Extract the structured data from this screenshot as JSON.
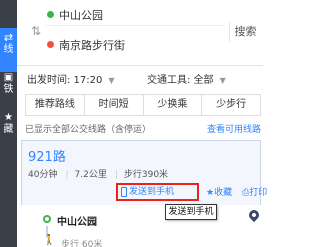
{
  "sidebar": {
    "items": [
      {
        "label": "线",
        "icon": "route-icon"
      },
      {
        "label": "铁",
        "icon": "bus-icon"
      },
      {
        "label": "藏",
        "icon": "star-icon"
      }
    ]
  },
  "search": {
    "from": "中山公园",
    "to": "南京路步行街",
    "button": "搜索",
    "swap_icon": "⇅"
  },
  "options": {
    "departure": "出发时间: 17:20",
    "tool": "交通工具: 全部"
  },
  "tabs": [
    "推荐路线",
    "时间短",
    "少换乘",
    "少步行"
  ],
  "info": {
    "text": "已显示全部公交线路（含停运）",
    "link": "查看可用线路"
  },
  "route": {
    "name": "921路",
    "duration": "40分钟",
    "distance": "7.2公里",
    "walk": "步行390米",
    "send_button": "发送到手机",
    "fav_button": "收藏",
    "print_button": "打印",
    "tooltip": "发送到手机"
  },
  "steps": {
    "start": "中山公园",
    "walk": "步行 60米"
  },
  "colors": {
    "sidebar_bg": "#3a3f4a",
    "accent": "#3385ff",
    "highlight_border": "#e8231c",
    "start": "#3bb54a",
    "end": "#f1503b"
  }
}
